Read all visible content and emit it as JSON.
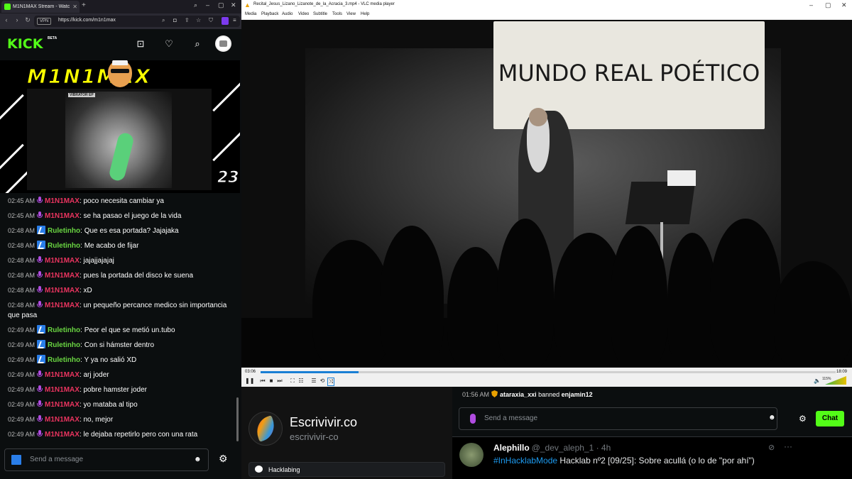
{
  "browser": {
    "tab_title": "M1N1MAX Stream - Watc",
    "url": "https://kick.com/m1n1max",
    "vpn": "VPN"
  },
  "kick": {
    "logo": "KICK",
    "beta": "BETA",
    "accent": "#53fc18"
  },
  "stream_art": {
    "title": "M1N1MAX",
    "number": "23",
    "xray_label": "VIBRATOR EP"
  },
  "chat": {
    "messages": [
      {
        "time": "02:45 AM",
        "user": "M1N1MAX",
        "type": "host",
        "text": ": poco necesita cambiar ya"
      },
      {
        "time": "02:45 AM",
        "user": "M1N1MAX",
        "type": "host",
        "text": ": se ha pasao el juego de la vida"
      },
      {
        "time": "02:48 AM",
        "user": "Ruletinho",
        "type": "sub",
        "text": ": Que es esa portada? Jajajaka"
      },
      {
        "time": "02:48 AM",
        "user": "Ruletinho",
        "type": "sub",
        "text": ": Me acabo de fijar"
      },
      {
        "time": "02:48 AM",
        "user": "M1N1MAX",
        "type": "host",
        "text": ": jajajjajajaj"
      },
      {
        "time": "02:48 AM",
        "user": "M1N1MAX",
        "type": "host",
        "text": ": pues la portada del disco ke suena"
      },
      {
        "time": "02:48 AM",
        "user": "M1N1MAX",
        "type": "host",
        "text": ": xD"
      },
      {
        "time": "02:48 AM",
        "user": "M1N1MAX",
        "type": "host",
        "text": ": un pequeño percance medico sin importancia que pasa"
      },
      {
        "time": "02:49 AM",
        "user": "Ruletinho",
        "type": "sub",
        "text": ": Peor el que se metió un.tubo"
      },
      {
        "time": "02:49 AM",
        "user": "Ruletinho",
        "type": "sub",
        "text": ": Con si hámster dentro"
      },
      {
        "time": "02:49 AM",
        "user": "Ruletinho",
        "type": "sub",
        "text": ": Y ya no salió XD"
      },
      {
        "time": "02:49 AM",
        "user": "M1N1MAX",
        "type": "host",
        "text": ": arj joder"
      },
      {
        "time": "02:49 AM",
        "user": "M1N1MAX",
        "type": "host",
        "text": ": pobre hamster joder"
      },
      {
        "time": "02:49 AM",
        "user": "M1N1MAX",
        "type": "host",
        "text": ": yo mataba al tipo"
      },
      {
        "time": "02:49 AM",
        "user": "M1N1MAX",
        "type": "host",
        "text": ": no, mejor"
      },
      {
        "time": "02:49 AM",
        "user": "M1N1MAX",
        "type": "host",
        "text": ": le dejaba repetirlo pero con una rata"
      }
    ],
    "input_placeholder": "Send a message"
  },
  "vlc": {
    "title": "Recital_Jesus_Lizano_Lizanote_de_la_Acracia_3.mp4 - VLC media player",
    "menu": [
      "Media",
      "Playback",
      "Audio",
      "Video",
      "Subtitle",
      "Tools",
      "View",
      "Help"
    ],
    "banner_text": "MUNDO REAL POÉTICO",
    "time_elapsed": "03:06",
    "time_total": "18:09",
    "progress": 0.17,
    "volume": "115%"
  },
  "profile": {
    "name": "Escrivivir.co",
    "handle": "escrivivir-co",
    "channel": "Hacklabing"
  },
  "chat2": {
    "ban_time": "01:56 AM",
    "ban_user": "ataraxia_xxi",
    "ban_word": " banned ",
    "ban_target": "enjamin12",
    "placeholder": "Send a message",
    "chat_button": "Chat"
  },
  "tweet": {
    "name": "Alephillo",
    "handle": "@_dev_aleph_1 · 4h",
    "hashtag": "#InHacklabMode",
    "text": " Hacklab nº2 [09/25]: Sobre acullá (o lo de \"por ahí\")"
  }
}
